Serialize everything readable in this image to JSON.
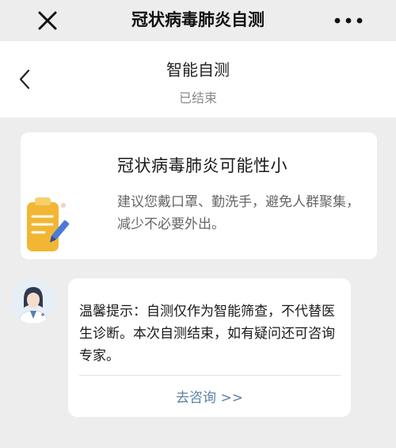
{
  "window": {
    "title": "冠状病毒肺炎自测",
    "close_icon": "close-icon",
    "more_icon": "more-dots-icon"
  },
  "subheader": {
    "title": "智能自测",
    "status": "已结束",
    "back_icon": "chevron-left-icon"
  },
  "result": {
    "icon": "clipboard-pen-icon",
    "title": "冠状病毒肺炎可能性小",
    "advice": "建议您戴口罩、勤洗手，避免人群聚集，减少不必要外出。"
  },
  "assistant": {
    "avatar_icon": "doctor-avatar-icon",
    "tip": "温馨提示：自测仅作为智能筛查，不代替医生诊断。本次自测结束，如有疑问还可咨询专家。",
    "consult_label": "去咨询 >>"
  },
  "colors": {
    "background": "#ededed",
    "card": "#ffffff",
    "link": "#5b7fa6",
    "clipboard": "#f2b632"
  }
}
